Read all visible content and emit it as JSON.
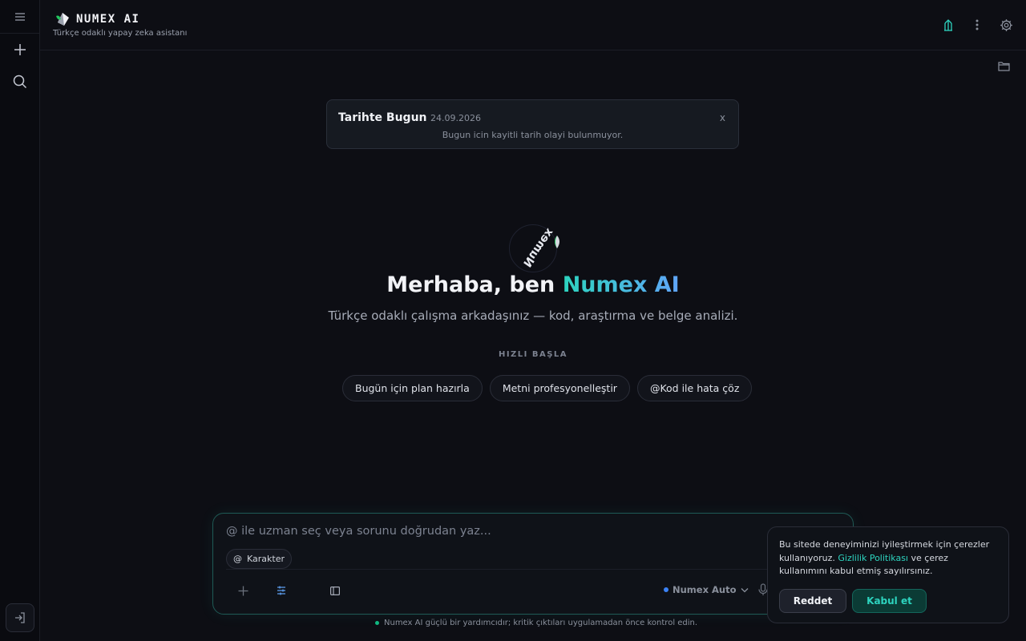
{
  "app": {
    "name": "NUMEX AI",
    "tagline": "Türkçe odaklı yapay zeka asistanı"
  },
  "history_card": {
    "title": "Tarihte Bugun",
    "date": "24.09.2026",
    "close_label": "x",
    "message": "Bugun icin kayitli tarih olayi bulunmuyor."
  },
  "hero": {
    "logo_text": "Numex",
    "title_prefix": "Merhaba, ben ",
    "title_accent": "Numex AI",
    "subtitle": "Türkçe odaklı çalışma arkadaşınız — kod, araştırma ve belge analizi.",
    "quick_start_label": "HIZLI BAŞLA",
    "chips": [
      "Bugün için plan hazırla",
      "Metni profesyonelleştir",
      "@Kod ile hata çöz"
    ]
  },
  "composer": {
    "placeholder": "@ ile uzman seç veya sorunu doğrudan yaz...",
    "character_label": "Karakter",
    "character_prefix": "@",
    "model_label": "Numex Auto"
  },
  "footnote": "Numex AI güçlü bir yardımcıdır; kritik çıktıları uygulamadan önce kontrol edin.",
  "cookie": {
    "text_before": "Bu sitede deneyiminizi iyileştirmek için çerezler kullanıyoruz. ",
    "link": "Gizlilik Politikası",
    "text_after": " ve çerez kullanımını kabul etmiş sayılırsınız.",
    "reject_label": "Reddet",
    "accept_label": "Kabul et"
  },
  "colors": {
    "background": "#0d0e14",
    "accent_teal": "#2dd4bf",
    "accent_blue": "#60a5fa",
    "model_dot": "#3b82f6"
  },
  "icons": {
    "sidebar": [
      "menu-icon",
      "plus-icon",
      "search-icon",
      "login-icon"
    ],
    "header": [
      "bank-icon",
      "more-vertical-icon",
      "gear-icon",
      "folder-icon"
    ],
    "composer": [
      "plus-icon",
      "sliders-icon",
      "panel-icon",
      "chevron-down-icon",
      "mic-icon"
    ]
  }
}
